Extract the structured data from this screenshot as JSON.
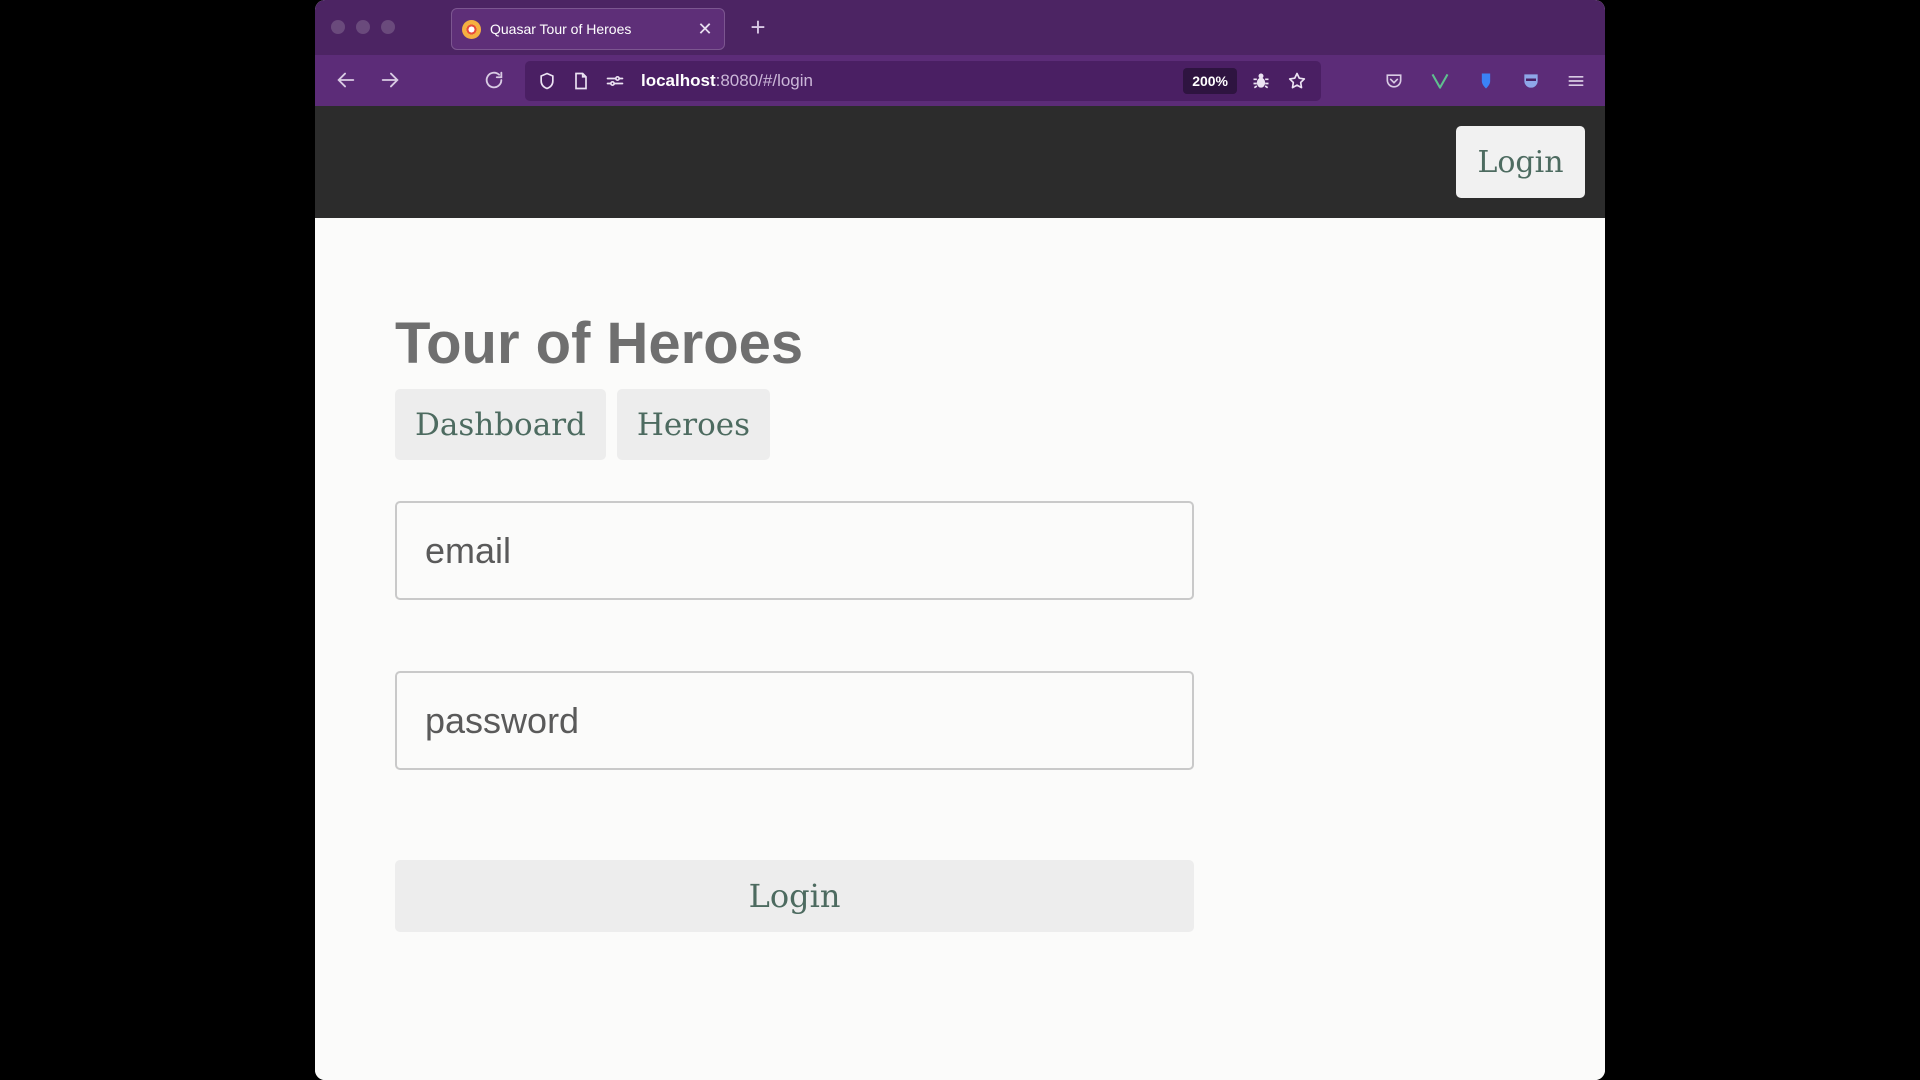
{
  "browser": {
    "tab": {
      "title": "Quasar Tour of Heroes",
      "favicon": "quasar-favicon-icon",
      "close": "✕"
    },
    "new_tab": "+",
    "url": {
      "host": "localhost",
      "rest": ":8080/#/login"
    },
    "zoom": "200%",
    "colors": {
      "tabstrip": "#4c2463",
      "navbar": "#5c2c78"
    }
  },
  "header": {
    "login_label": "Login"
  },
  "main": {
    "title": "Tour of Heroes",
    "nav": [
      {
        "label": "Dashboard"
      },
      {
        "label": "Heroes"
      }
    ],
    "email_placeholder": "email",
    "password_placeholder": "password",
    "login_label": "Login"
  },
  "theme": {
    "header_bg": "#2c2c2c",
    "accent_text": "#4d6b60",
    "title_color": "#6f6f6f"
  }
}
